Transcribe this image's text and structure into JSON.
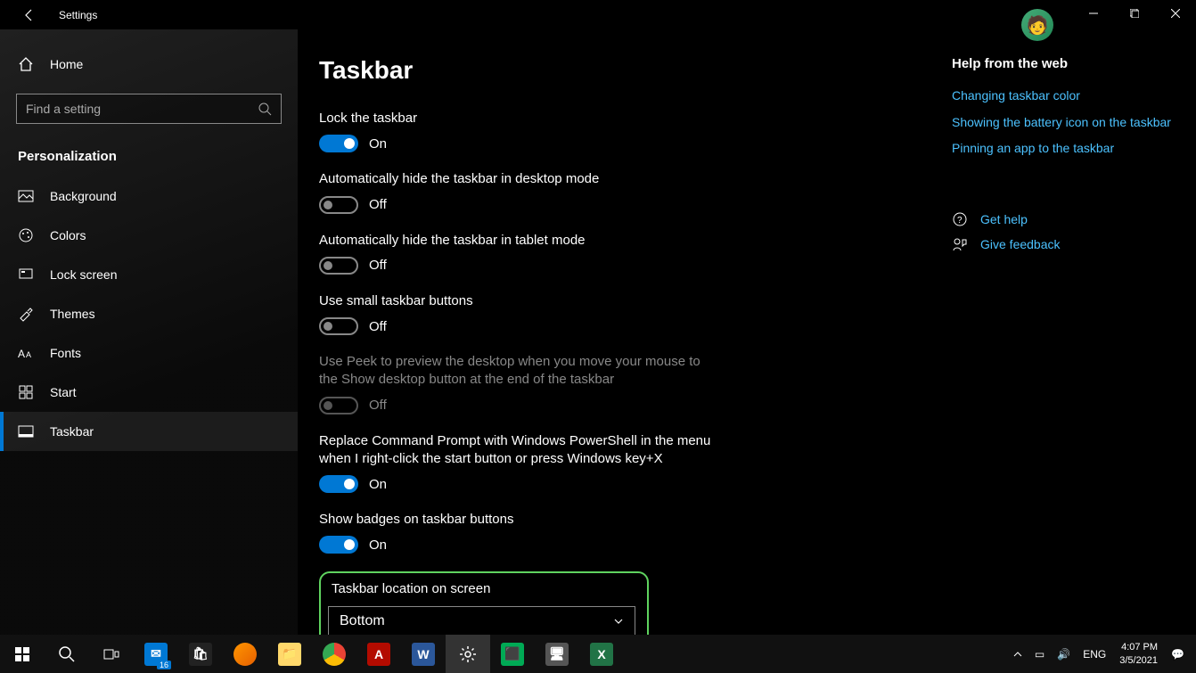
{
  "titlebar": {
    "title": "Settings"
  },
  "sidebar": {
    "home": "Home",
    "search_placeholder": "Find a setting",
    "category": "Personalization",
    "items": [
      {
        "label": "Background"
      },
      {
        "label": "Colors"
      },
      {
        "label": "Lock screen"
      },
      {
        "label": "Themes"
      },
      {
        "label": "Fonts"
      },
      {
        "label": "Start"
      },
      {
        "label": "Taskbar"
      }
    ]
  },
  "page": {
    "title": "Taskbar",
    "settings": [
      {
        "label": "Lock the taskbar",
        "on": true,
        "state": "On"
      },
      {
        "label": "Automatically hide the taskbar in desktop mode",
        "on": false,
        "state": "Off"
      },
      {
        "label": "Automatically hide the taskbar in tablet mode",
        "on": false,
        "state": "Off"
      },
      {
        "label": "Use small taskbar buttons",
        "on": false,
        "state": "Off"
      },
      {
        "label": "Use Peek to preview the desktop when you move your mouse to the Show desktop button at the end of the taskbar",
        "on": false,
        "state": "Off",
        "disabled": true
      },
      {
        "label": "Replace Command Prompt with Windows PowerShell in the menu when I right-click the start button or press Windows key+X",
        "on": true,
        "state": "On"
      },
      {
        "label": "Show badges on taskbar buttons",
        "on": true,
        "state": "On"
      }
    ],
    "location_label": "Taskbar location on screen",
    "location_value": "Bottom"
  },
  "help": {
    "title": "Help from the web",
    "links": [
      "Changing taskbar color",
      "Showing the battery icon on the taskbar",
      "Pinning an app to the taskbar"
    ],
    "get_help": "Get help",
    "feedback": "Give feedback"
  },
  "tray": {
    "lang": "ENG",
    "time": "4:07 PM",
    "date": "3/5/2021",
    "mail_badge": "16"
  }
}
